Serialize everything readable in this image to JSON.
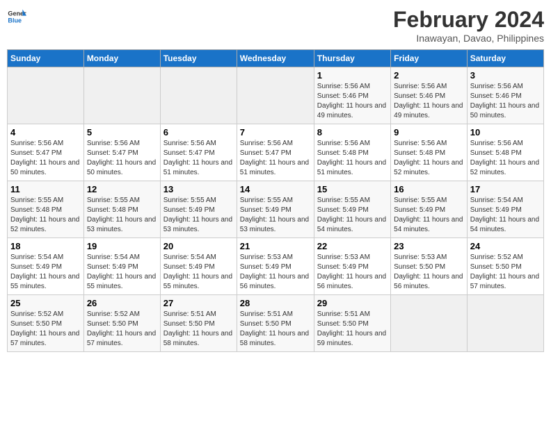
{
  "logo": {
    "text_general": "General",
    "text_blue": "Blue"
  },
  "title": "February 2024",
  "subtitle": "Inawayan, Davao, Philippines",
  "weekdays": [
    "Sunday",
    "Monday",
    "Tuesday",
    "Wednesday",
    "Thursday",
    "Friday",
    "Saturday"
  ],
  "weeks": [
    [
      {
        "day": "",
        "empty": true
      },
      {
        "day": "",
        "empty": true
      },
      {
        "day": "",
        "empty": true
      },
      {
        "day": "",
        "empty": true
      },
      {
        "day": "1",
        "sunrise": "5:56 AM",
        "sunset": "5:46 PM",
        "daylight": "11 hours and 49 minutes."
      },
      {
        "day": "2",
        "sunrise": "5:56 AM",
        "sunset": "5:46 PM",
        "daylight": "11 hours and 49 minutes."
      },
      {
        "day": "3",
        "sunrise": "5:56 AM",
        "sunset": "5:46 PM",
        "daylight": "11 hours and 50 minutes."
      }
    ],
    [
      {
        "day": "4",
        "sunrise": "5:56 AM",
        "sunset": "5:47 PM",
        "daylight": "11 hours and 50 minutes."
      },
      {
        "day": "5",
        "sunrise": "5:56 AM",
        "sunset": "5:47 PM",
        "daylight": "11 hours and 50 minutes."
      },
      {
        "day": "6",
        "sunrise": "5:56 AM",
        "sunset": "5:47 PM",
        "daylight": "11 hours and 51 minutes."
      },
      {
        "day": "7",
        "sunrise": "5:56 AM",
        "sunset": "5:47 PM",
        "daylight": "11 hours and 51 minutes."
      },
      {
        "day": "8",
        "sunrise": "5:56 AM",
        "sunset": "5:48 PM",
        "daylight": "11 hours and 51 minutes."
      },
      {
        "day": "9",
        "sunrise": "5:56 AM",
        "sunset": "5:48 PM",
        "daylight": "11 hours and 52 minutes."
      },
      {
        "day": "10",
        "sunrise": "5:56 AM",
        "sunset": "5:48 PM",
        "daylight": "11 hours and 52 minutes."
      }
    ],
    [
      {
        "day": "11",
        "sunrise": "5:55 AM",
        "sunset": "5:48 PM",
        "daylight": "11 hours and 52 minutes."
      },
      {
        "day": "12",
        "sunrise": "5:55 AM",
        "sunset": "5:48 PM",
        "daylight": "11 hours and 53 minutes."
      },
      {
        "day": "13",
        "sunrise": "5:55 AM",
        "sunset": "5:49 PM",
        "daylight": "11 hours and 53 minutes."
      },
      {
        "day": "14",
        "sunrise": "5:55 AM",
        "sunset": "5:49 PM",
        "daylight": "11 hours and 53 minutes."
      },
      {
        "day": "15",
        "sunrise": "5:55 AM",
        "sunset": "5:49 PM",
        "daylight": "11 hours and 54 minutes."
      },
      {
        "day": "16",
        "sunrise": "5:55 AM",
        "sunset": "5:49 PM",
        "daylight": "11 hours and 54 minutes."
      },
      {
        "day": "17",
        "sunrise": "5:54 AM",
        "sunset": "5:49 PM",
        "daylight": "11 hours and 54 minutes."
      }
    ],
    [
      {
        "day": "18",
        "sunrise": "5:54 AM",
        "sunset": "5:49 PM",
        "daylight": "11 hours and 55 minutes."
      },
      {
        "day": "19",
        "sunrise": "5:54 AM",
        "sunset": "5:49 PM",
        "daylight": "11 hours and 55 minutes."
      },
      {
        "day": "20",
        "sunrise": "5:54 AM",
        "sunset": "5:49 PM",
        "daylight": "11 hours and 55 minutes."
      },
      {
        "day": "21",
        "sunrise": "5:53 AM",
        "sunset": "5:49 PM",
        "daylight": "11 hours and 56 minutes."
      },
      {
        "day": "22",
        "sunrise": "5:53 AM",
        "sunset": "5:49 PM",
        "daylight": "11 hours and 56 minutes."
      },
      {
        "day": "23",
        "sunrise": "5:53 AM",
        "sunset": "5:50 PM",
        "daylight": "11 hours and 56 minutes."
      },
      {
        "day": "24",
        "sunrise": "5:52 AM",
        "sunset": "5:50 PM",
        "daylight": "11 hours and 57 minutes."
      }
    ],
    [
      {
        "day": "25",
        "sunrise": "5:52 AM",
        "sunset": "5:50 PM",
        "daylight": "11 hours and 57 minutes."
      },
      {
        "day": "26",
        "sunrise": "5:52 AM",
        "sunset": "5:50 PM",
        "daylight": "11 hours and 57 minutes."
      },
      {
        "day": "27",
        "sunrise": "5:51 AM",
        "sunset": "5:50 PM",
        "daylight": "11 hours and 58 minutes."
      },
      {
        "day": "28",
        "sunrise": "5:51 AM",
        "sunset": "5:50 PM",
        "daylight": "11 hours and 58 minutes."
      },
      {
        "day": "29",
        "sunrise": "5:51 AM",
        "sunset": "5:50 PM",
        "daylight": "11 hours and 59 minutes."
      },
      {
        "day": "",
        "empty": true
      },
      {
        "day": "",
        "empty": true
      }
    ]
  ]
}
